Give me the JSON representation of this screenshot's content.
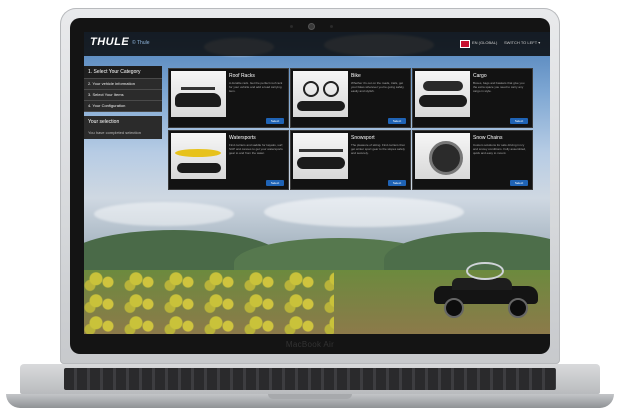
{
  "device": {
    "model_label": "MacBook Air"
  },
  "brand": {
    "logo": "THULE",
    "logo_sub": "© Thule"
  },
  "topbar": {
    "region": "EN (GLOBAL)",
    "link": "SWITCH TO LEFT ▾"
  },
  "sidebar": {
    "steps": [
      {
        "label": "1. Select Your Category",
        "active": true
      },
      {
        "label": "2. Your vehicle information",
        "active": false
      },
      {
        "label": "3. Select Your Items",
        "active": false
      },
      {
        "label": "4. Your Configuration",
        "active": false
      }
    ],
    "selection_title": "Your selection",
    "selection_text": "You have completed selection"
  },
  "categories": [
    {
      "title": "Roof Racks",
      "desc": "A durable rack. Get the perfect roof rack for your vehicle and add a load carrying item.",
      "button": "Select"
    },
    {
      "title": "Bike",
      "desc": "Whether it’s out on the roads, trails, get your bikes wherever you’re going safely, easily and stylish.",
      "button": "Select"
    },
    {
      "title": "Cargo",
      "desc": "Boxes, bags and baskets that give you the extra space you need to carry any cargo in style.",
      "button": "Select"
    },
    {
      "title": "Watersports",
      "desc": "Find carriers and saddle for kayaks, surf, SUP and canoes to get your watersports gear to and from the water.",
      "button": "Select"
    },
    {
      "title": "Snowsport",
      "desc": "The pleasure of skiing. Find carriers that get winter sport gear to the slopes safely and securely.",
      "button": "Select"
    },
    {
      "title": "Snow Chains",
      "desc": "Custom solutions for safe driving in icy and snowy conditions. Fully assembled, quick and easy to mount.",
      "button": "Select"
    }
  ]
}
